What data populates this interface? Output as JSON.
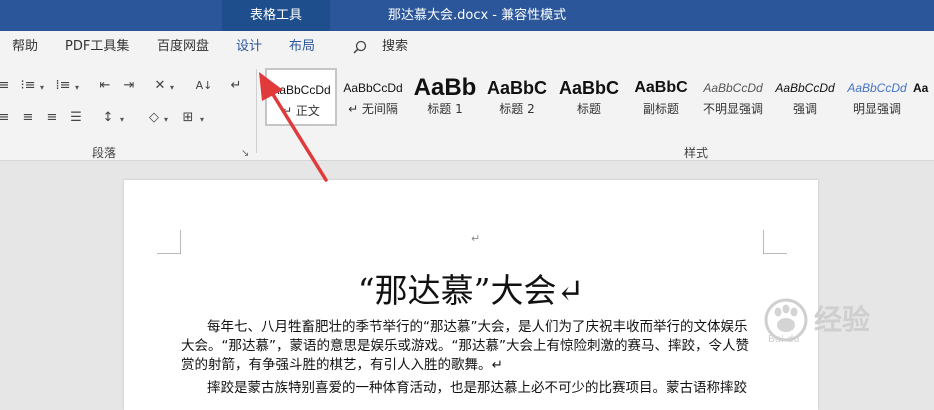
{
  "titlebar": {
    "context_tab": "表格工具",
    "doc_title": "那达慕大会.docx  -  兼容性模式"
  },
  "tabs": [
    "帮助",
    "PDF工具集",
    "百度网盘",
    "设计",
    "布局",
    "搜索"
  ],
  "ribbon": {
    "paragraph_label": "段落",
    "styles_label": "样式",
    "styles": [
      {
        "preview": "AaBbCcDd",
        "name": "↵ 正文"
      },
      {
        "preview": "AaBbCcDd",
        "name": "↵ 无间隔"
      },
      {
        "preview": "AaBb",
        "name": "标题 1"
      },
      {
        "preview": "AaBbC",
        "name": "标题 2"
      },
      {
        "preview": "AaBbC",
        "name": "标题"
      },
      {
        "preview": "AaBbC",
        "name": "副标题"
      },
      {
        "preview": "AaBbCcDd",
        "name": "不明显强调"
      },
      {
        "preview": "AaBbCcDd",
        "name": "强调"
      },
      {
        "preview": "AaBbCcDd",
        "name": "明显强调"
      },
      {
        "preview": "Aa",
        "name": ""
      }
    ]
  },
  "document": {
    "top_mark": "↵",
    "heading": "“那达慕”大会↵",
    "lines": [
      "每年七、八月牲畜肥壮的季节举行的“那达慕”大会，是人们为了庆祝丰收而举行的文体娱乐",
      "大会。“那达慕”，蒙语的意思是娱乐或游戏。“那达慕”大会上有惊险刺激的赛马、摔跤，令人赞",
      "赏的射箭，有争强斗胜的棋艺，有引人入胜的歌舞。↵",
      "摔跤是蒙古族特别喜爱的一种体育活动，也是那达慕上必不可少的比赛项目。蒙古语称摔跤"
    ]
  },
  "watermark": {
    "text": "经验",
    "sub": "Bai du"
  }
}
